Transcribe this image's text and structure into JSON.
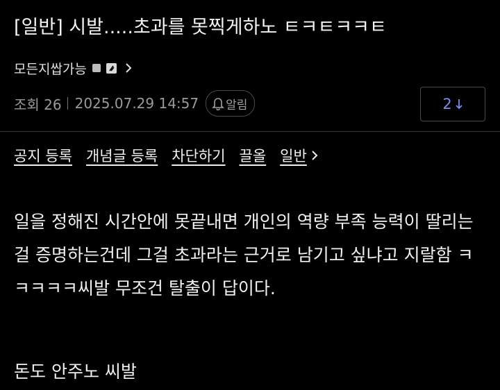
{
  "post": {
    "title": "[일반] 시발.....초과를 못찍게하노 ㅌㅋㅌㅋㅋㅌ",
    "author": "모든지쌉가능",
    "views": "조회 26",
    "datetime": "2025.07.29 14:57",
    "alarm_label": "알림",
    "comment_count": "2",
    "body_paragraph_1": "일을 정해진 시간안에 못끝내면 개인의 역량 부족 능력이 딸리는 걸 증명하는건데 그걸 초과라는 근거로 남기고 싶냐고 지랄함 ㅋㅋㅋㅋㅋ씨발 무조건 탈출이 답이다.",
    "body_paragraph_2": "돈도 안주노 씨발"
  },
  "links": {
    "notice": "공지 등록",
    "concept": "개념글 등록",
    "block": "차단하기",
    "pull": "끌올",
    "category": "일반"
  },
  "colors": {
    "background": "#000000",
    "text": "#f0f0f0",
    "muted": "#9a9a9a",
    "accent": "#7c8cf0"
  },
  "icons": {
    "author_badge": "gray-square-icon",
    "fixed_badge": "fixed-nick-icon",
    "author_chevron": "chevron-right-icon",
    "alarm": "bell-icon",
    "comment_arrow": "arrow-down-icon",
    "category_chevron": "chevron-right-icon"
  }
}
